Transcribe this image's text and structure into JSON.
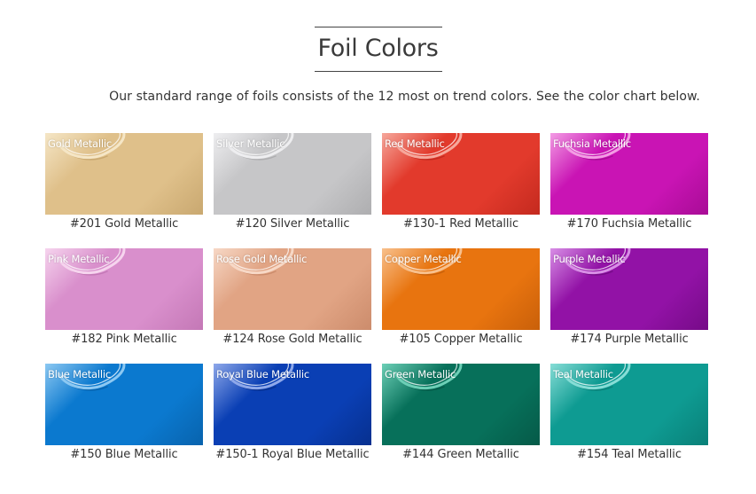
{
  "header": {
    "title": "Foil Colors",
    "intro": "Our standard range of foils consists of the 12 most on trend colors. See the color chart below."
  },
  "swatches": [
    {
      "label": "Gold Metallic",
      "caption": "#201 Gold Metallic",
      "color": "#dfc08a",
      "shade": "#c9a870",
      "highlight": "#f5e6c6"
    },
    {
      "label": "Silver Metallic",
      "caption": "#120 Silver Metallic",
      "color": "#c6c6c8",
      "shade": "#aeaeb0",
      "highlight": "#eeeef0"
    },
    {
      "label": "Red Metallic",
      "caption": "#130-1 Red Metallic",
      "color": "#e23a2c",
      "shade": "#c42a1f",
      "highlight": "#f6a79b"
    },
    {
      "label": "Fuchsia Metallic",
      "caption": "#170 Fuchsia Metallic",
      "color": "#c914b4",
      "shade": "#a80c96",
      "highlight": "#f39ce4"
    },
    {
      "label": "Pink Metallic",
      "caption": "#182 Pink Metallic",
      "color": "#d98fcc",
      "shade": "#c478b6",
      "highlight": "#f6d4ee"
    },
    {
      "label": "Rose Gold Metallic",
      "caption": "#124 Rose Gold Metallic",
      "color": "#e1a484",
      "shade": "#cc8c6c",
      "highlight": "#f7d8c6"
    },
    {
      "label": "Copper Metallic",
      "caption": "#105 Copper Metallic",
      "color": "#e8740f",
      "shade": "#c9600a",
      "highlight": "#f8c08c"
    },
    {
      "label": "Purple Metallic",
      "caption": "#174 Purple Metallic",
      "color": "#9212a6",
      "shade": "#760b88",
      "highlight": "#d88ee6"
    },
    {
      "label": "Blue Metallic",
      "caption": "#150 Blue Metallic",
      "color": "#0b79cf",
      "shade": "#0863ad",
      "highlight": "#8cc8f2"
    },
    {
      "label": "Royal Blue Metallic",
      "caption": "#150-1 Royal Blue Metallic",
      "color": "#0a3fb4",
      "shade": "#07308f",
      "highlight": "#8ea8ea"
    },
    {
      "label": "Green Metallic",
      "caption": "#144 Green Metallic",
      "color": "#07705a",
      "shade": "#055a48",
      "highlight": "#6ccfb6"
    },
    {
      "label": "Teal Metallic",
      "caption": "#154 Teal Metallic",
      "color": "#0e9b92",
      "shade": "#0a8078",
      "highlight": "#86ddd6"
    }
  ]
}
